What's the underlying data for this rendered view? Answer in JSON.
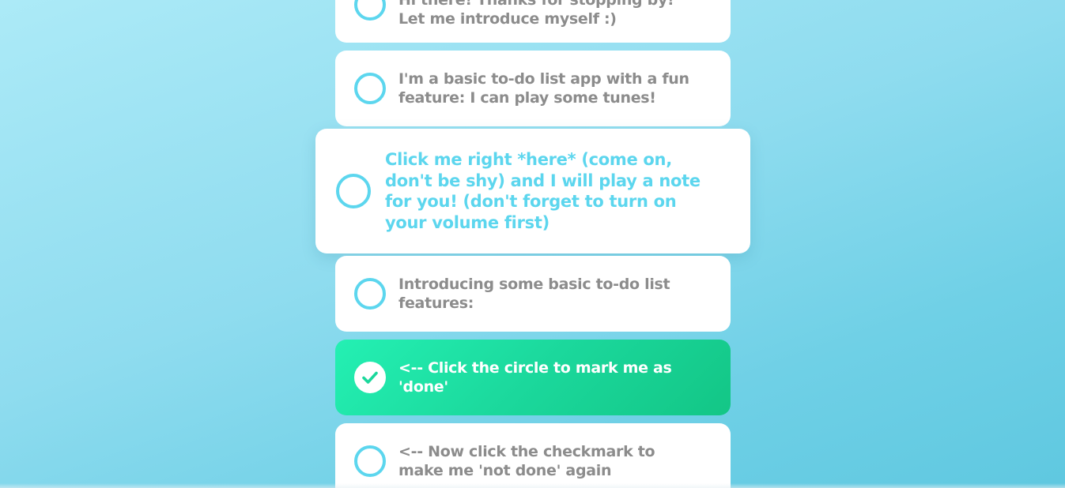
{
  "todos": [
    {
      "text": "Hi there! Thanks for stopping by! Let me introduce myself :)",
      "done": false
    },
    {
      "text": "I'm a basic to-do list app with a fun feature: I can play some tunes!",
      "done": false
    },
    {
      "text": "Click me right *here* (come on, don't be shy) and I will play a note for you! (don't forget to turn on your volume first)",
      "done": false
    },
    {
      "text": "Introducing some basic to-do list features:",
      "done": false
    },
    {
      "text": "<-- Click the circle to mark me as 'done'",
      "done": true
    },
    {
      "text": "<-- Now click the checkmark to make me 'not done' again",
      "done": false
    }
  ],
  "colors": {
    "accent": "#5cd6ee",
    "done_start": "#24f0b3",
    "done_end": "#13c686",
    "text_muted": "#8c8c8c",
    "background_light": "#aceaf7",
    "background_dark": "#5fc8e0"
  },
  "icons": {
    "checkmark": "check-icon"
  }
}
